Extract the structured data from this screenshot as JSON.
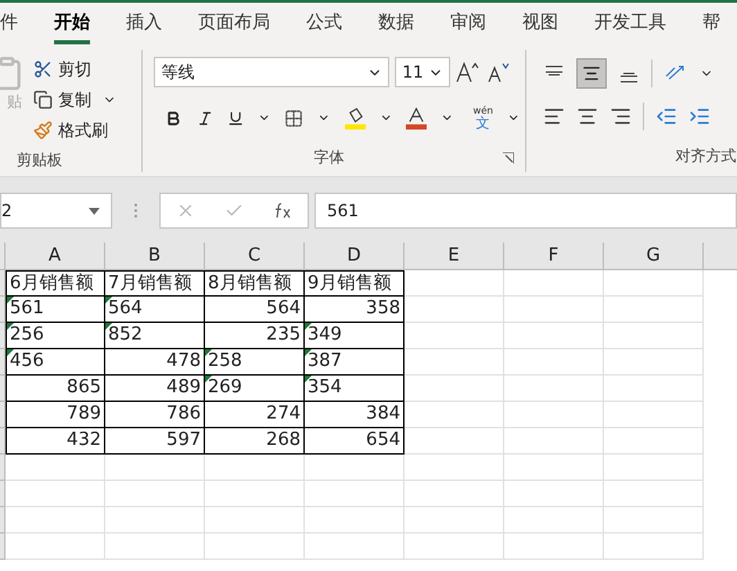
{
  "tabs": [
    {
      "label": "件",
      "selected": false
    },
    {
      "label": "开始",
      "selected": true
    },
    {
      "label": "插入",
      "selected": false
    },
    {
      "label": "页面布局",
      "selected": false
    },
    {
      "label": "公式",
      "selected": false
    },
    {
      "label": "数据",
      "selected": false
    },
    {
      "label": "审阅",
      "selected": false
    },
    {
      "label": "视图",
      "selected": false
    },
    {
      "label": "开发工具",
      "selected": false
    },
    {
      "label": "帮",
      "selected": false
    }
  ],
  "clipboard": {
    "paste": "贴",
    "cut": "剪切",
    "copy": "复制",
    "format_painter": "格式刷",
    "label": "剪贴板"
  },
  "font": {
    "name": "等线",
    "size": "11",
    "phonetic": "wén",
    "phonetic_char": "文",
    "label": "字体"
  },
  "alignment": {
    "label": "对齐方式"
  },
  "formula_bar": {
    "name_box": "2",
    "formula": "561"
  },
  "columns": [
    "A",
    "B",
    "C",
    "D",
    "E",
    "F",
    "G"
  ],
  "rows": [
    {
      "cells": [
        {
          "kind": "header",
          "text": "6月销售额"
        },
        {
          "kind": "header",
          "text": "7月销售额"
        },
        {
          "kind": "header",
          "text": "8月销售额"
        },
        {
          "kind": "header",
          "text": "9月销售额"
        }
      ]
    },
    {
      "cells": [
        {
          "kind": "text",
          "text": "561"
        },
        {
          "kind": "text",
          "text": "564"
        },
        {
          "kind": "number",
          "text": "564"
        },
        {
          "kind": "number",
          "text": "358"
        }
      ]
    },
    {
      "cells": [
        {
          "kind": "text",
          "text": "256"
        },
        {
          "kind": "text",
          "text": "852"
        },
        {
          "kind": "number",
          "text": "235"
        },
        {
          "kind": "text",
          "text": "349"
        }
      ]
    },
    {
      "cells": [
        {
          "kind": "text",
          "text": "456"
        },
        {
          "kind": "number",
          "text": "478"
        },
        {
          "kind": "text",
          "text": "258"
        },
        {
          "kind": "text",
          "text": "387"
        }
      ]
    },
    {
      "cells": [
        {
          "kind": "number",
          "text": "865"
        },
        {
          "kind": "number",
          "text": "489"
        },
        {
          "kind": "text",
          "text": "269"
        },
        {
          "kind": "text",
          "text": "354"
        }
      ]
    },
    {
      "cells": [
        {
          "kind": "number",
          "text": "789"
        },
        {
          "kind": "number",
          "text": "786"
        },
        {
          "kind": "number",
          "text": "274"
        },
        {
          "kind": "number",
          "text": "384"
        }
      ]
    },
    {
      "cells": [
        {
          "kind": "number",
          "text": "432"
        },
        {
          "kind": "number",
          "text": "597"
        },
        {
          "kind": "number",
          "text": "268"
        },
        {
          "kind": "number",
          "text": "654"
        }
      ]
    }
  ]
}
